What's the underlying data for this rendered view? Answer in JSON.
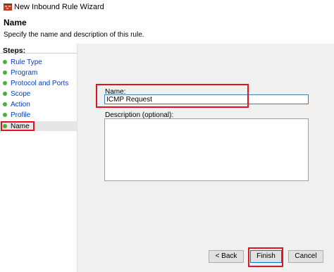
{
  "window": {
    "title": "New Inbound Rule Wizard"
  },
  "header": {
    "title": "Name",
    "description": "Specify the name and description of this rule."
  },
  "steps": {
    "heading": "Steps:",
    "items": [
      {
        "label": "Rule Type"
      },
      {
        "label": "Program"
      },
      {
        "label": "Protocol and Ports"
      },
      {
        "label": "Scope"
      },
      {
        "label": "Action"
      },
      {
        "label": "Profile"
      },
      {
        "label": "Name"
      }
    ],
    "selected": "Name"
  },
  "form": {
    "name_label": "Name:",
    "name_value": "ICMP Request",
    "description_label": "Description (optional):",
    "description_value": ""
  },
  "buttons": {
    "back": "< Back",
    "finish": "Finish",
    "cancel": "Cancel"
  },
  "colors": {
    "highlight": "#e0141e",
    "step_dot": "#4caf3a",
    "step_link": "#0040c0"
  }
}
